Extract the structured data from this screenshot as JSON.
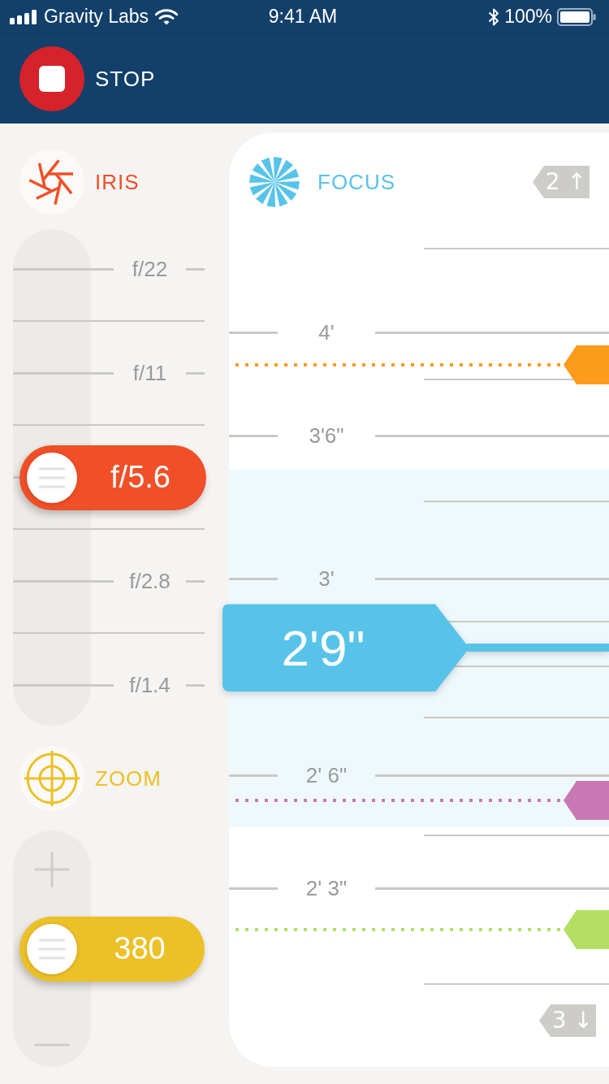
{
  "status_bar": {
    "carrier": "Gravity Labs",
    "time": "9:41 AM",
    "battery": "100%"
  },
  "header": {
    "stop_button": {
      "label": "STOP"
    }
  },
  "iris": {
    "label": "IRIS",
    "ticks": [
      {
        "kind": "major",
        "label": "f/22"
      },
      {
        "kind": "minor"
      },
      {
        "kind": "major",
        "label": "f/11"
      },
      {
        "kind": "minor"
      },
      {
        "kind": "major"
      },
      {
        "kind": "minor"
      },
      {
        "kind": "major",
        "label": "f/2.8"
      },
      {
        "kind": "minor"
      },
      {
        "kind": "major",
        "label": "f/1.4"
      }
    ],
    "thumb": {
      "value": "f/5.6",
      "level": 0.5
    }
  },
  "zoom": {
    "label": "ZOOM",
    "thumb": {
      "value": "380",
      "level": 0.5
    }
  },
  "focus": {
    "label": "FOCUS",
    "above": {
      "count": "2",
      "arrow": "↑"
    },
    "ticks": [
      {
        "kind": "minor"
      },
      {
        "kind": "major",
        "label": "4'"
      },
      {
        "kind": "minor"
      },
      {
        "kind": "major",
        "label": "3'6\""
      },
      {
        "kind": "minor"
      },
      {
        "kind": "major",
        "label": "3'"
      },
      {
        "kind": "minor"
      },
      {
        "kind": "minor"
      },
      {
        "kind": "minor"
      },
      {
        "kind": "major",
        "label": "2' 6\""
      },
      {
        "kind": "minor"
      },
      {
        "kind": "major",
        "label": "2' 3\""
      },
      {
        "kind": "minor"
      }
    ],
    "markers": [
      {
        "color": "#fd9b1d"
      },
      {
        "color": "#c878b3"
      },
      {
        "color": "#b3e063"
      }
    ],
    "thumb": {
      "value": "2'9\"",
      "level": 0.445
    },
    "below": {
      "count": "3",
      "arrow": "↓"
    }
  }
}
